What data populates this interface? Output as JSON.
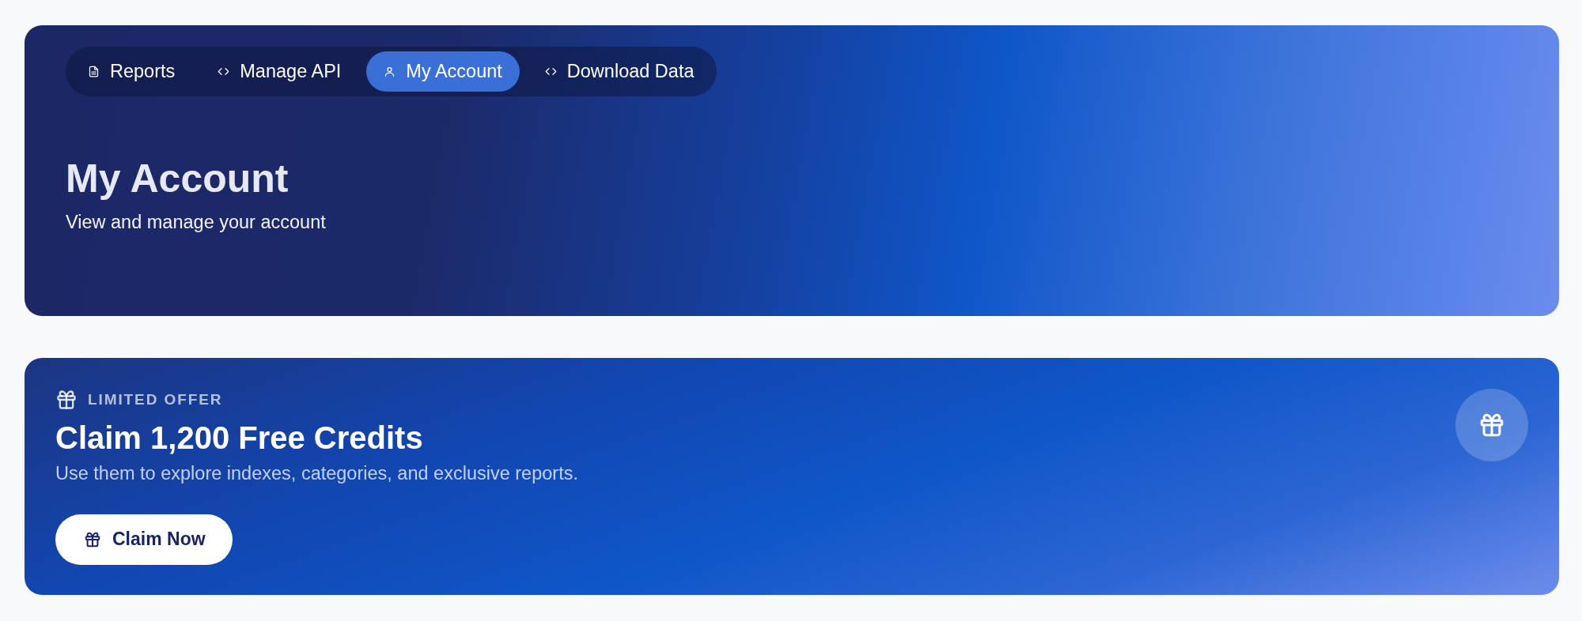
{
  "nav": {
    "tabs": [
      {
        "label": "Reports",
        "kind": "document",
        "selected": false
      },
      {
        "label": "Manage API",
        "kind": "code",
        "selected": false
      },
      {
        "label": "My Account",
        "kind": "person",
        "selected": true
      },
      {
        "label": "Download Data",
        "kind": "code",
        "selected": false
      }
    ]
  },
  "header": {
    "title": "My Account",
    "subtitle": "View and manage your account"
  },
  "offer": {
    "eyebrow": "LIMITED OFFER",
    "title": "Claim 1,200 Free Credits",
    "description": "Use them to explore indexes, categories, and exclusive reports.",
    "button": "Claim Now"
  }
}
